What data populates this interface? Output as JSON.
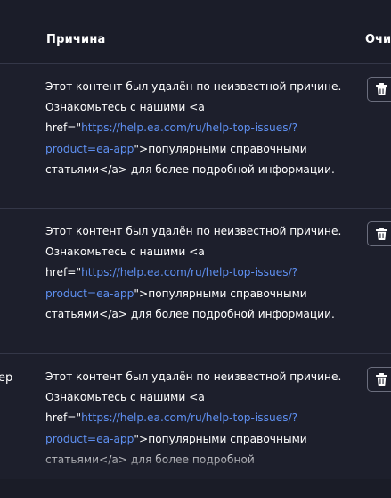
{
  "table": {
    "columns": {
      "reason": "Причина",
      "clear": "Очи"
    },
    "rows": [
      {
        "left_cut": "",
        "reason_before_link": "Этот контент был удалён по неизвестной причине. Ознакомьтесь с нашими <a href=\"",
        "reason_link": "https://help.ea.com/ru/help-top-issues/?product=ea-app",
        "reason_after_link": "\">популярными справочными статьями</a> для более подробной информации.",
        "delete_icon": "trash-icon"
      },
      {
        "left_cut": "",
        "reason_before_link": "Этот контент был удалён по неизвестной причине. Ознакомьтесь с нашими <a href=\"",
        "reason_link": "https://help.ea.com/ru/help-top-issues/?product=ea-app",
        "reason_after_link": "\">популярными справочными статьями</a> для более подробной информации.",
        "delete_icon": "trash-icon"
      },
      {
        "left_cut": "ер",
        "reason_before_link": "Этот контент был удалён по неизвестной причине. Ознакомьтесь с нашими <a href=\"",
        "reason_link": "https://help.ea.com/ru/help-top-issues/?product=ea-app",
        "reason_after_link": "\">популярными справочными статьями</a> для более подробной",
        "delete_icon": "trash-icon"
      }
    ]
  },
  "colors": {
    "background": "#1d1f2c",
    "link": "#5e8ff0",
    "divider": "#343748"
  }
}
